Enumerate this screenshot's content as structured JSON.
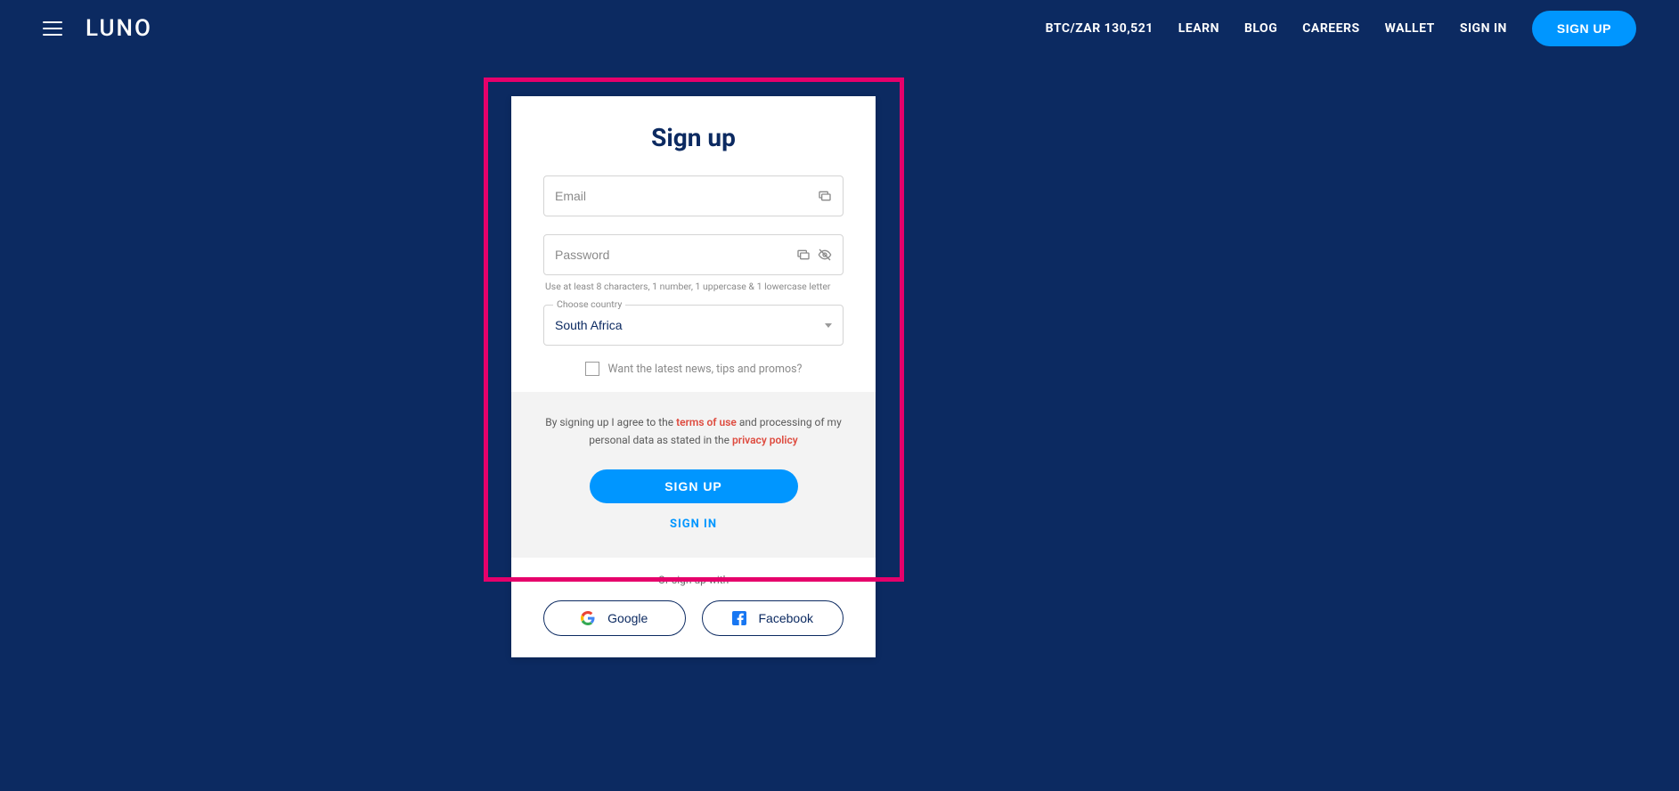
{
  "header": {
    "logo": "LUNO",
    "nav": {
      "price": "BTC/ZAR 130,521",
      "learn": "LEARN",
      "blog": "BLOG",
      "careers": "CAREERS",
      "wallet": "WALLET",
      "signin": "SIGN IN",
      "signup": "SIGN UP"
    }
  },
  "form": {
    "title": "Sign up",
    "email_placeholder": "Email",
    "password_placeholder": "Password",
    "password_hint": "Use at least 8 characters, 1 number, 1 uppercase & 1 lowercase letter",
    "country_label": "Choose country",
    "country_value": "South Africa",
    "promo_label": "Want the latest news, tips and promos?",
    "legal_prefix": "By signing up I agree to the ",
    "terms_link": "terms of use",
    "legal_mid": " and processing of my personal data as stated in the ",
    "privacy_link": "privacy policy",
    "signup_button": "SIGN UP",
    "signin_link": "SIGN IN"
  },
  "social": {
    "label": "Or sign up with",
    "google": "Google",
    "facebook": "Facebook"
  }
}
